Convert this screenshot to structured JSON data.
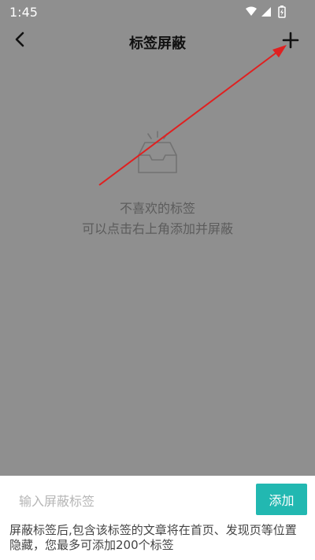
{
  "status_bar": {
    "time": "1:45"
  },
  "header": {
    "title": "标签屏蔽"
  },
  "empty_state": {
    "line1": "不喜欢的标签",
    "line2": "可以点击右上角添加并屏蔽"
  },
  "input_panel": {
    "placeholder": "输入屏蔽标签",
    "add_label": "添加",
    "note": "屏蔽标签后,包含该标签的文章将在首页、发现页等位置隐藏，您最多可添加200个标签"
  },
  "colors": {
    "overlay_bg": "#8f8f8f",
    "accent": "#22b8b1",
    "annotation_arrow": "#e02020"
  },
  "icons": {
    "back": "chevron-left-icon",
    "add": "plus-icon",
    "empty": "empty-tray-icon"
  }
}
